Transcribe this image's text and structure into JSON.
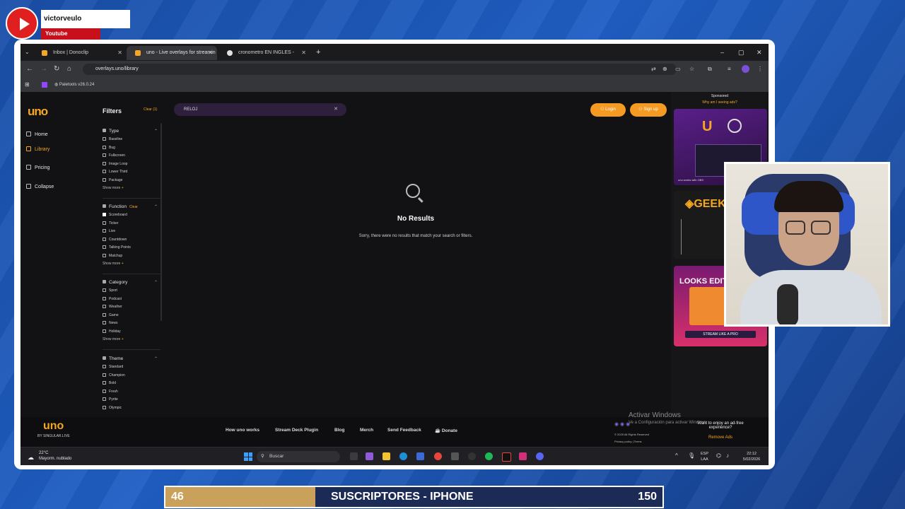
{
  "overlay": {
    "yt_channel": "victorveulo",
    "yt_platform": "Youtube",
    "banner": {
      "left_value": "46",
      "title": "SUSCRIPTORES - IPHONE",
      "right_value": "150"
    }
  },
  "browser": {
    "tabs": [
      {
        "label": "Inbox | Donoclip",
        "favicon_color": "#f5a623",
        "active": false
      },
      {
        "label": "uno - Live overlays for streamin",
        "favicon_color": "#f5a623",
        "active": true
      },
      {
        "label": "cronometro EN INGLES - Buscar",
        "favicon_color": "#e0e0e0",
        "active": false
      }
    ],
    "new_tab": "+",
    "window_controls": {
      "minimize": "–",
      "maximize": "▢",
      "close": "✕"
    },
    "url": "overlays.uno/library",
    "bookmarks": [
      {
        "label": "Paletools v26.0.24"
      }
    ]
  },
  "app": {
    "logo": "uno",
    "nav": [
      {
        "label": "Home",
        "active": false
      },
      {
        "label": "Library",
        "active": true
      },
      {
        "label": "Pricing",
        "active": false
      },
      {
        "label": "Collapse",
        "active": false
      }
    ],
    "filters": {
      "title": "Filters",
      "clear_all": "Clear (1)",
      "groups": [
        {
          "name": "Type",
          "clear": "",
          "items": [
            {
              "label": "Baseline",
              "checked": false
            },
            {
              "label": "Bug",
              "checked": false
            },
            {
              "label": "Fullscreen",
              "checked": false
            },
            {
              "label": "Image Loop",
              "checked": false
            },
            {
              "label": "Lower Third",
              "checked": false
            },
            {
              "label": "Package",
              "checked": false
            }
          ],
          "show_more": true
        },
        {
          "name": "Function",
          "clear": "Clear",
          "items": [
            {
              "label": "Scoreboard",
              "checked": true
            },
            {
              "label": "Ticker",
              "checked": false
            },
            {
              "label": "Live",
              "checked": false
            },
            {
              "label": "Countdown",
              "checked": false
            },
            {
              "label": "Talking Points",
              "checked": false
            },
            {
              "label": "Matchup",
              "checked": false
            }
          ],
          "show_more": true
        },
        {
          "name": "Category",
          "clear": "",
          "items": [
            {
              "label": "Sport",
              "checked": false
            },
            {
              "label": "Podcast",
              "checked": false
            },
            {
              "label": "Weather",
              "checked": false
            },
            {
              "label": "Game",
              "checked": false
            },
            {
              "label": "News",
              "checked": false
            },
            {
              "label": "Holiday",
              "checked": false
            }
          ],
          "show_more": true
        },
        {
          "name": "Theme",
          "clear": "",
          "items": [
            {
              "label": "Standard",
              "checked": false
            },
            {
              "label": "Champion",
              "checked": false
            },
            {
              "label": "Bold",
              "checked": false
            },
            {
              "label": "Fresh",
              "checked": false
            },
            {
              "label": "Pyrite",
              "checked": false
            },
            {
              "label": "Olympic",
              "checked": false
            }
          ],
          "show_more": false
        }
      ],
      "show_more_label": "Show more"
    },
    "search": {
      "value": "RELOJ",
      "clear": "✕"
    },
    "buttons": {
      "login": "Login",
      "signup": "Sign up"
    },
    "no_results": {
      "title": "No Results",
      "message": "Sorry, there were no results that match your search or filters."
    },
    "sidebar_ads": {
      "sponsored": "Sponsored",
      "why": "Why am I seeing ads?",
      "ad1_caption": "uno works with OBS",
      "ad2_brand": "GEEK",
      "ad3_title": "LOOKS EDITED",
      "ad3_cta": "STREAM LIKE A PRO"
    },
    "footer": {
      "logo": "uno",
      "by": "BY SINGULAR.LIVE",
      "links": [
        "How uno works",
        "Stream Deck Plugin",
        "Blog",
        "Merch",
        "Send Feedback",
        "Donate"
      ],
      "copyright": "© 2025 All Rights Reserved",
      "privacy": "Privacy policy",
      "terms": "Terms",
      "ad_free": "Want to enjoy an ad-free experience?",
      "remove_ads": "Remove Ads"
    }
  },
  "windows": {
    "activate_title": "Activar Windows",
    "activate_sub": "Ve a Configuración para activar Windows.",
    "weather_temp": "22°C",
    "weather_desc": "Mayorm. nublado",
    "search_placeholder": "Buscar",
    "lang": "ESP",
    "lang2": "LAA",
    "time": "22:12",
    "date": "5/02/2026"
  }
}
